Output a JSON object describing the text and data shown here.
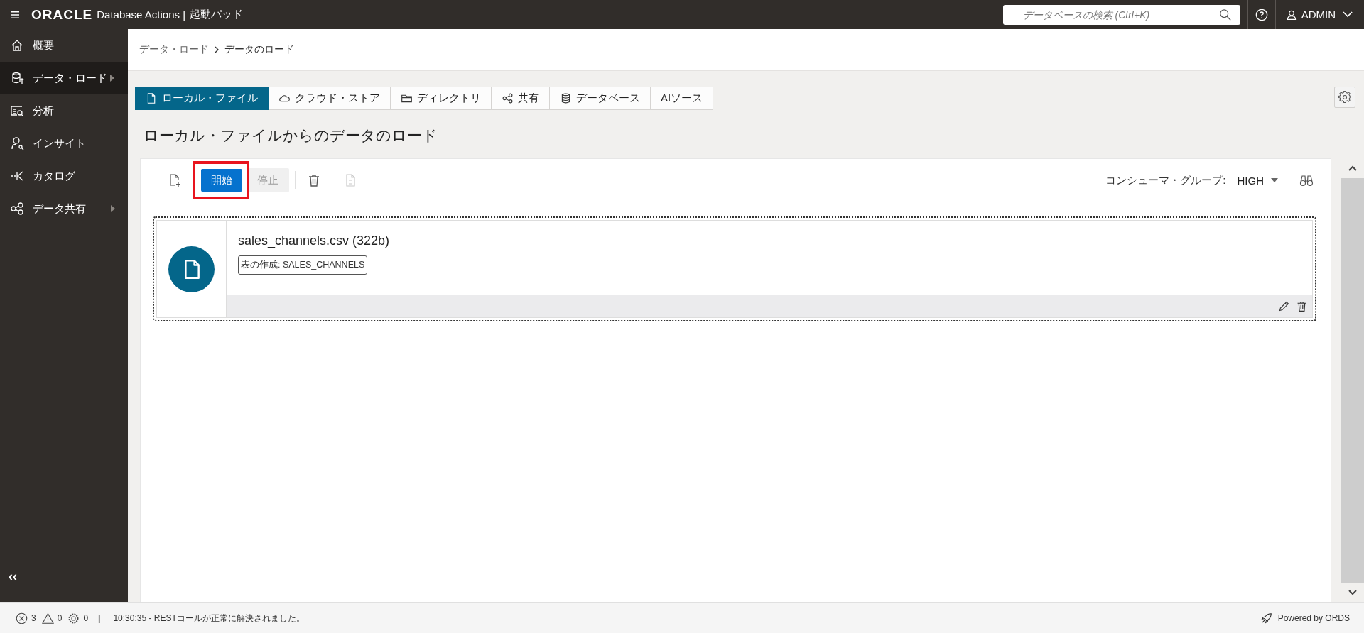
{
  "header": {
    "logo": "ORACLE",
    "product": "Database Actions |",
    "page": "起動パッド",
    "search": {
      "placeholder": "データベースの検索 (Ctrl+K)"
    },
    "user": "ADMIN"
  },
  "sidebar": {
    "items": [
      {
        "label": "概要",
        "selected": false,
        "expandable": false
      },
      {
        "label": "データ・ロード",
        "selected": true,
        "expandable": true
      },
      {
        "label": "分析",
        "selected": false,
        "expandable": false
      },
      {
        "label": "インサイト",
        "selected": false,
        "expandable": false
      },
      {
        "label": "カタログ",
        "selected": false,
        "expandable": false
      },
      {
        "label": "データ共有",
        "selected": false,
        "expandable": true
      }
    ],
    "collapse": "‹‹"
  },
  "breadcrumb": [
    "データ・ロード",
    "データのロード"
  ],
  "tabs": [
    {
      "label": "ローカル・ファイル",
      "selected": true
    },
    {
      "label": "クラウド・ストア",
      "selected": false
    },
    {
      "label": "ディレクトリ",
      "selected": false
    },
    {
      "label": "共有",
      "selected": false
    },
    {
      "label": "データベース",
      "selected": false
    },
    {
      "label": "AIソース",
      "selected": false
    }
  ],
  "title": "ローカル・ファイルからのデータのロード",
  "toolbar": {
    "start": {
      "label": "開始",
      "disabled": false,
      "highlighted": true
    },
    "stop": {
      "label": "停止",
      "disabled": true
    },
    "consumer_group_label": "コンシューマ・グループ:",
    "consumer_group": "HIGH"
  },
  "files": [
    {
      "name": "sales_channels.csv (322b)",
      "tag": "表の作成: SALES_CHANNELS"
    }
  ],
  "status_bar": {
    "errors": "3",
    "warnings": "0",
    "tasks": "0",
    "separator": "|",
    "message": "10:30:35 - RESTコールが正常に解決されました。",
    "powered": "Powered by ORDS"
  }
}
